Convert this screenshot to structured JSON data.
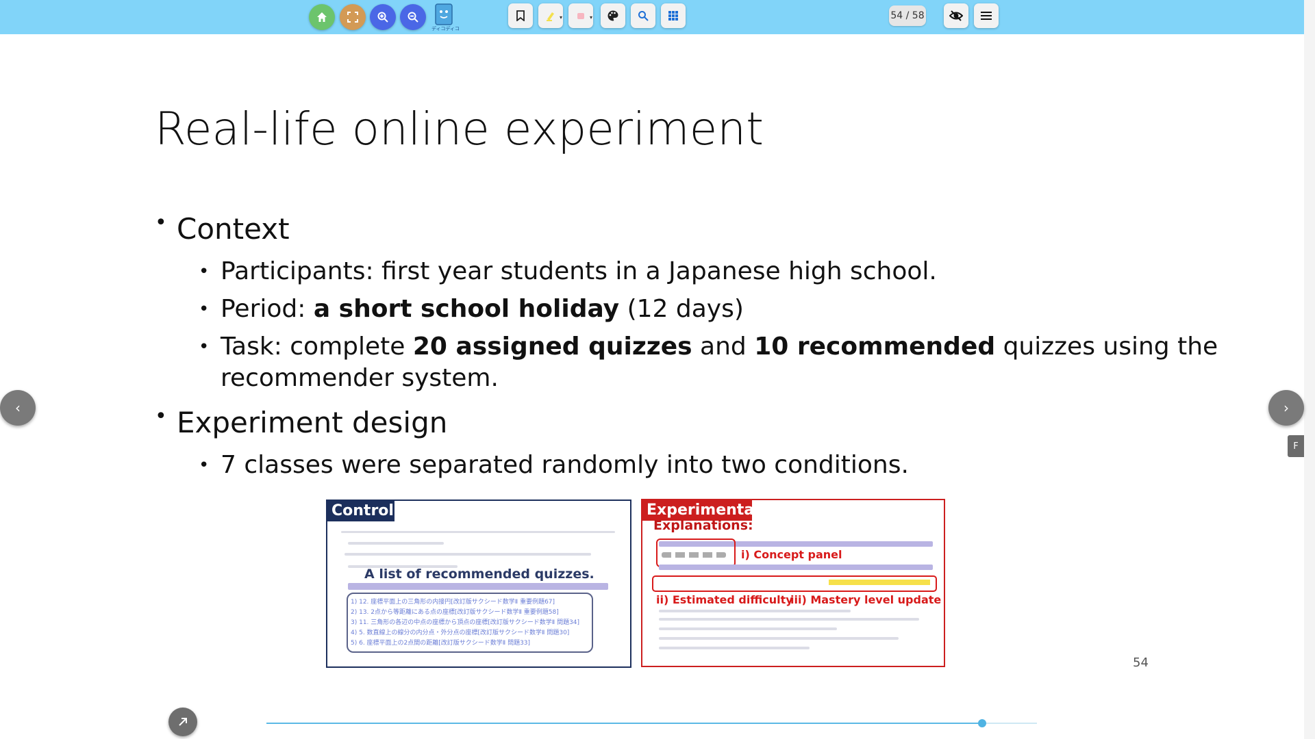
{
  "toolbar": {
    "page_counter": "54 / 58",
    "logo_caption": "ディコディコ",
    "colors": {
      "background": "#81d4f9",
      "home": "#6cc46c",
      "fullscreen": "#d39a55",
      "zoom": "#4a67e6"
    },
    "icons": [
      "home-icon",
      "fullscreen-icon",
      "zoom-in-icon",
      "zoom-out-icon",
      "bookmark-icon",
      "highlighter-icon",
      "eraser-icon",
      "palette-icon",
      "search-icon",
      "grid-icon",
      "eye-off-icon",
      "menu-icon"
    ]
  },
  "slide": {
    "title": "Real-life online experiment",
    "bullets": {
      "context": "Context",
      "participants": "Participants: first year students in a Japanese high school.",
      "period_prefix": "Period: ",
      "period_bold": "a short school holiday",
      "period_suffix": " (12 days)",
      "task_prefix": "Task: complete ",
      "task_bold1": "20 assigned quizzes",
      "task_mid": " and ",
      "task_bold2": "10 recommended",
      "task_suffix": " quizzes using the",
      "task_line2": "recommender system.",
      "design": "Experiment design",
      "classes": "7 classes were separated randomly into two conditions."
    },
    "control": {
      "label": "Control",
      "callout": "A list of recommended quizzes.",
      "rows": [
        "1) 12.  座標平面上の三角形の内接円[改訂版サクシード数学Ⅱ 重要例題67]",
        "2) 13.  2点から等距離にある点の座標[改訂版サクシード数学Ⅱ 重要例題58]",
        "3) 11.  三角形の各辺の中点の座標から頂点の座標[改訂版サクシード数学Ⅱ 問題34]",
        "4) 5.  数直線上の線分の内分点・外分点の座標[改訂版サクシード数学Ⅱ 問題30]",
        "5) 6.  座標平面上の2点間の距離[改訂版サクシード数学Ⅱ 問題33]"
      ],
      "border_color": "#1c2f5c"
    },
    "experimental": {
      "label": "Experimental",
      "explanations": "Explanations:",
      "concept_panel": "i) Concept panel",
      "estimated_difficulty": "ii) Estimated difficulty",
      "mastery_update": "iii) Mastery level update",
      "border_color": "#cc1f1f"
    },
    "page_number": "54"
  },
  "progress": {
    "fraction": 0.929
  }
}
